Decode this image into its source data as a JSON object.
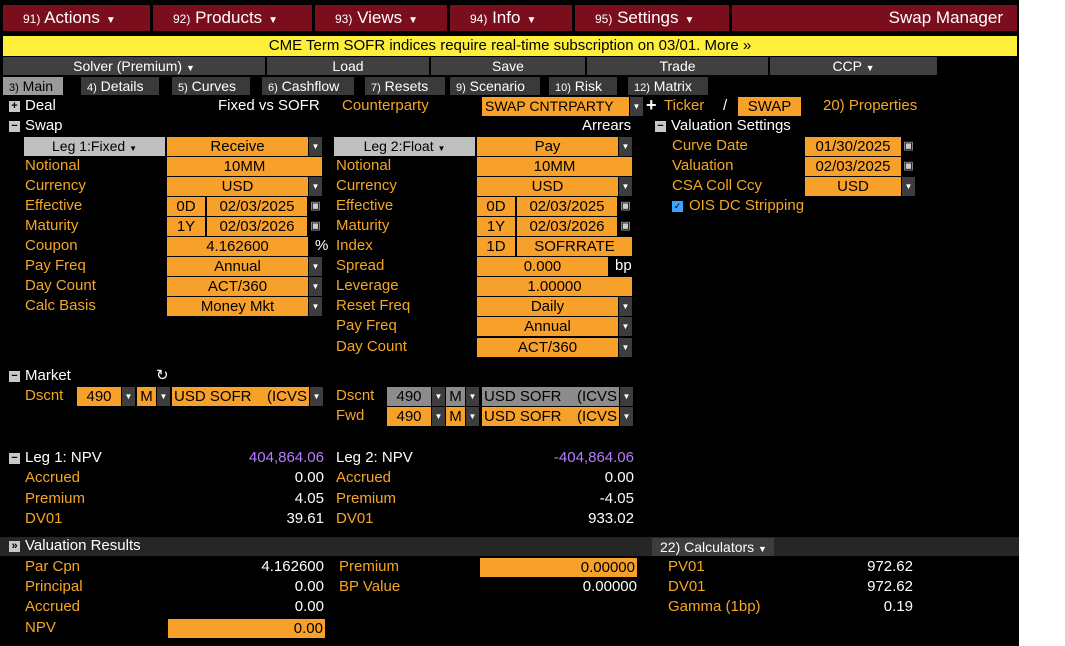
{
  "menu": {
    "actions": {
      "num": "91)",
      "label": "Actions"
    },
    "products": {
      "num": "92)",
      "label": "Products"
    },
    "views": {
      "num": "93)",
      "label": "Views"
    },
    "info": {
      "num": "94)",
      "label": "Info"
    },
    "settings": {
      "num": "95)",
      "label": "Settings"
    },
    "app_title": "Swap Manager"
  },
  "banner": "CME Term SOFR indices require real-time subscription on 03/01. More »",
  "toolbar": {
    "solver": "Solver (Premium)",
    "load": "Load",
    "save": "Save",
    "trade": "Trade",
    "ccp": "CCP"
  },
  "tabs": [
    {
      "num": "3)",
      "label": "Main"
    },
    {
      "num": "4)",
      "label": "Details"
    },
    {
      "num": "5)",
      "label": "Curves"
    },
    {
      "num": "6)",
      "label": "Cashflow"
    },
    {
      "num": "7)",
      "label": "Resets"
    },
    {
      "num": "9)",
      "label": "Scenario"
    },
    {
      "num": "10)",
      "label": "Risk"
    },
    {
      "num": "12)",
      "label": "Matrix"
    }
  ],
  "deal": {
    "label": "Deal",
    "type": "Fixed vs SOFR",
    "counterparty_label": "Counterparty",
    "counterparty": "SWAP CNTRPARTY",
    "ticker_label": "Ticker",
    "ticker_sep": "/",
    "ticker": "SWAP",
    "properties": "20) Properties"
  },
  "swap": {
    "label": "Swap",
    "arrears": "Arrears"
  },
  "leg1": {
    "header": "Leg 1:Fixed",
    "direction": "Receive",
    "notional_label": "Notional",
    "notional": "10MM",
    "currency_label": "Currency",
    "currency": "USD",
    "effective_label": "Effective",
    "effective_tenor": "0D",
    "effective": "02/03/2025",
    "maturity_label": "Maturity",
    "maturity_tenor": "1Y",
    "maturity": "02/03/2026",
    "coupon_label": "Coupon",
    "coupon": "4.162600",
    "coupon_unit": "%",
    "payfreq_label": "Pay Freq",
    "payfreq": "Annual",
    "daycount_label": "Day Count",
    "daycount": "ACT/360",
    "calcbasis_label": "Calc Basis",
    "calcbasis": "Money Mkt"
  },
  "leg2": {
    "header": "Leg 2:Float",
    "direction": "Pay",
    "notional_label": "Notional",
    "notional": "10MM",
    "currency_label": "Currency",
    "currency": "USD",
    "effective_label": "Effective",
    "effective_tenor": "0D",
    "effective": "02/03/2025",
    "maturity_label": "Maturity",
    "maturity_tenor": "1Y",
    "maturity": "02/03/2026",
    "index_label": "Index",
    "index_tenor": "1D",
    "index": "SOFRRATE",
    "spread_label": "Spread",
    "spread": "0.000",
    "spread_unit": "bp",
    "leverage_label": "Leverage",
    "leverage": "1.00000",
    "resetfreq_label": "Reset Freq",
    "resetfreq": "Daily",
    "payfreq_label": "Pay Freq",
    "payfreq": "Annual",
    "daycount_label": "Day Count",
    "daycount": "ACT/360"
  },
  "valuation_settings": {
    "label": "Valuation Settings",
    "curve_date_label": "Curve Date",
    "curve_date": "01/30/2025",
    "valuation_label": "Valuation",
    "valuation": "02/03/2025",
    "csa_label": "CSA Coll Ccy",
    "csa": "USD",
    "ois_label": "OIS DC Stripping",
    "ois_checked": true
  },
  "market": {
    "label": "Market",
    "dscnt1_label": "Dscnt",
    "dscnt1_num": "490",
    "dscnt1_m": "M",
    "dscnt1_curve": "USD SOFR",
    "dscnt1_src": "(ICVS",
    "dscnt2_label": "Dscnt",
    "dscnt2_num": "490",
    "dscnt2_m": "M",
    "dscnt2_curve": "USD SOFR",
    "dscnt2_src": "(ICVS",
    "fwd_label": "Fwd",
    "fwd_num": "490",
    "fwd_m": "M",
    "fwd_curve": "USD SOFR",
    "fwd_src": "(ICVS"
  },
  "results_leg1": {
    "npv_label": "Leg 1: NPV",
    "npv": "404,864.06",
    "accrued_label": "Accrued",
    "accrued": "0.00",
    "premium_label": "Premium",
    "premium": "4.05",
    "dv01_label": "DV01",
    "dv01": "39.61"
  },
  "results_leg2": {
    "npv_label": "Leg 2: NPV",
    "npv": "-404,864.06",
    "accrued_label": "Accrued",
    "accrued": "0.00",
    "premium_label": "Premium",
    "premium": "-4.05",
    "dv01_label": "DV01",
    "dv01": "933.02"
  },
  "valuation_results": {
    "label": "Valuation Results",
    "calculators": "22) Calculators",
    "parcpn_label": "Par Cpn",
    "parcpn": "4.162600",
    "principal_label": "Principal",
    "principal": "0.00",
    "accrued_label": "Accrued",
    "accrued": "0.00",
    "npv_label": "NPV",
    "npv": "0.00",
    "premium_label": "Premium",
    "premium": "0.00000",
    "bpvalue_label": "BP Value",
    "bpvalue": "0.00000",
    "pv01_label": "PV01",
    "pv01": "972.62",
    "dv01_label": "DV01",
    "dv01": "972.62",
    "gamma_label": "Gamma (1bp)",
    "gamma": "0.19"
  },
  "colors": {
    "menu_bg": "#7a0e1c",
    "banner_bg": "#ffef3a",
    "field_bg": "#f7a12b",
    "label": "#f5a623",
    "npv_value": "#b77cff"
  }
}
